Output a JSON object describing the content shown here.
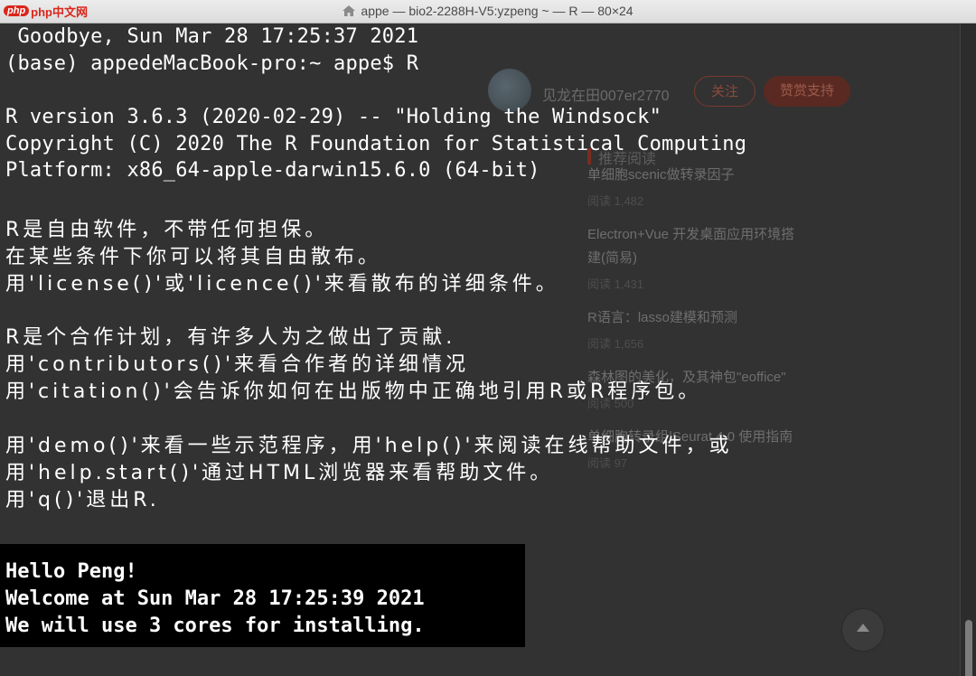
{
  "window": {
    "title": "appe — bio2-2288H-V5:yzpeng ~ — R — 80×24",
    "watermark_site": "php中文网"
  },
  "background_page": {
    "author_name": "见龙在田007er2770",
    "follow_label": "关注",
    "support_label": "赞赏支持",
    "recommended_heading": "推荐阅读",
    "recommended": [
      {
        "title": "单细胞scenic做转录因子",
        "meta": "阅读 1,482"
      },
      {
        "title_line1": "Electron+Vue 开发桌面应用环境搭",
        "title_line2": "建(简易)",
        "meta": "阅读 1,431"
      },
      {
        "title": "R语言：lasso建模和预测",
        "meta": "阅读 1,656"
      },
      {
        "title": "森林图的美化，及其神包\"eoffice\"",
        "meta": "阅读 500"
      },
      {
        "title": "单细胞转录组|Seurat 4.0 使用指南",
        "meta": "阅读 97"
      }
    ]
  },
  "terminal": {
    "lines": [
      " Goodbye, Sun Mar 28 17:25:37 2021",
      "(base) appedeMacBook-pro:~ appe$ R",
      "R version 3.6.3 (2020-02-29) -- \"Holding the Windsock\"",
      "Copyright (C) 2020 The R Foundation for Statistical Computing",
      "Platform: x86_64-apple-darwin15.6.0 (64-bit)",
      "R是自由软件，不带任何担保。",
      "在某些条件下你可以将其自由散布。",
      "用'license()'或'licence()'来看散布的详细条件。",
      "R是个合作计划，有许多人为之做出了贡献.",
      "用'contributors()'来看合作者的详细情况",
      "用'citation()'会告诉你如何在出版物中正确地引用R或R程序包。",
      "用'demo()'来看一些示范程序，用'help()'来阅读在线帮助文件，或",
      "用'help.start()'通过HTML浏览器来看帮助文件。",
      "用'q()'退出R."
    ],
    "greeting": [
      "Hello Peng!",
      "Welcome at Sun Mar 28 17:25:39 2021",
      "We will use 3 cores for installing."
    ],
    "prompt": ">"
  }
}
